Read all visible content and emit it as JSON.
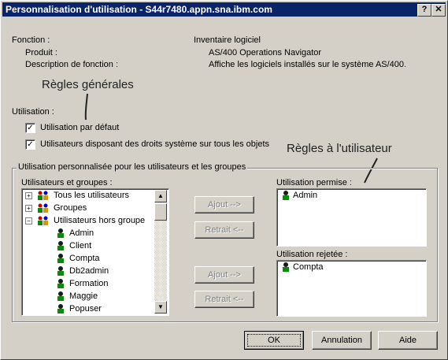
{
  "window": {
    "title": "Personnalisation d'utilisation - S44r7480.appn.sna.ibm.com",
    "help_btn": "?",
    "close_btn": "✕"
  },
  "info": {
    "fonction_label": "Fonction :",
    "fonction_value": "Inventaire logiciel",
    "produit_label": "Produit :",
    "produit_value": "AS/400 Operations Navigator",
    "desc_label": "Description de fonction :",
    "desc_value": "Affiche les logiciels installés sur le système AS/400."
  },
  "annotations": {
    "regles_generales": "Règles générales",
    "regles_utilisateur": "Règles à l'utilisateur"
  },
  "utilisation": {
    "label": "Utilisation :",
    "checkbox1": {
      "label": "Utilisation par défaut",
      "checked": true
    },
    "checkbox2": {
      "label": "Utilisateurs disposant des droits système sur tous les objets",
      "checked": true
    }
  },
  "group": {
    "label": "Utilisation personnalisée pour les utilisateurs et les groupes",
    "users_label": "Utilisateurs et groupes :",
    "users_items": [
      {
        "label": "Tous les utilisateurs",
        "expander": "+"
      },
      {
        "label": "Groupes",
        "expander": "+"
      },
      {
        "label": "Utilisateurs hors groupe",
        "expander": "−"
      },
      {
        "label": "Admin"
      },
      {
        "label": "Client"
      },
      {
        "label": "Compta"
      },
      {
        "label": "Db2admin"
      },
      {
        "label": "Formation"
      },
      {
        "label": "Maggie"
      },
      {
        "label": "Popuser"
      }
    ],
    "ajout1": "Ajout -->",
    "retrait1": "Retrait <--",
    "ajout2": "Ajout -->",
    "retrait2": "Retrait <--",
    "permise_label": "Utilisation permise :",
    "permise_items": [
      "Admin"
    ],
    "rejetee_label": "Utilisation rejetée :",
    "rejetee_items": [
      "Compta"
    ]
  },
  "buttons": {
    "ok": "OK",
    "annulation": "Annulation",
    "aide": "Aide"
  }
}
